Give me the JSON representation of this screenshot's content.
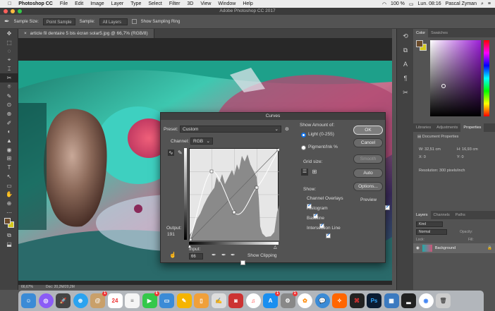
{
  "menubar": {
    "app": "Photoshop CC",
    "items": [
      "File",
      "Edit",
      "Image",
      "Layer",
      "Type",
      "Select",
      "Filter",
      "3D",
      "View",
      "Window",
      "Help"
    ],
    "battery": "100 %",
    "clock": "Lun. 08:16",
    "user": "Pascal Zyman"
  },
  "window": {
    "title": "Adobe Photoshop CC 2017"
  },
  "options": {
    "sample_size_label": "Sample Size:",
    "sample_size_value": "Point Sample",
    "sample_label": "Sample:",
    "sample_value": "All Layers",
    "show_ring": "Show Sampling Ring"
  },
  "document": {
    "tab": "article fil dentaire 5 bis écran solar5.jpg @ 66,7% (RGB/8)",
    "zoom": "66,67%",
    "doc_info": "Doc: 20,2M/20,2M"
  },
  "tools": [
    "✥",
    "⬚",
    "◌",
    "⌖",
    "⌶",
    "✂",
    "⌾",
    "✎",
    "⊙",
    "⊕",
    "✐",
    "◐",
    "▲",
    "◉",
    "⊞",
    "T",
    "↖",
    "▭",
    "✋",
    "⊕",
    "⋯",
    "▣",
    "⧉",
    "⬓"
  ],
  "colors": {
    "fg": "#6b4b2a",
    "bg": "#d4c91e",
    "accent": "#1473e6"
  },
  "color_panel": {
    "tabs": [
      "Color",
      "Swatches"
    ]
  },
  "properties": {
    "tabs": [
      "Libraries",
      "Adjustments",
      "Properties"
    ],
    "heading": "Document Properties",
    "w_label": "W:",
    "w_value": "32,51 cm",
    "h_label": "H:",
    "h_value": "16,93 cm",
    "x_label": "X:",
    "x_value": "0",
    "y_label": "Y:",
    "y_value": "0",
    "resolution": "Resolution: 300 pixels/inch"
  },
  "layers": {
    "tabs": [
      "Layers",
      "Channels",
      "Paths"
    ],
    "kind": "Kind",
    "mode": "Normal",
    "opacity_label": "Opacity:",
    "lock_label": "Lock:",
    "fill_label": "Fill:",
    "layer_name": "Background"
  },
  "curves": {
    "title": "Curves",
    "preset_label": "Preset:",
    "preset_value": "Custom",
    "channel_label": "Channel:",
    "channel_value": "RGB",
    "output_label": "Output:",
    "output_value": "191",
    "input_label": "Input:",
    "input_value": "66",
    "show_clipping": "Show Clipping",
    "show_amount_label": "Show Amount of:",
    "light": "Light  (0-255)",
    "pigment": "Pigment/Ink %",
    "grid_size": "Grid size:",
    "show_label": "Show:",
    "opts": [
      "Channel Overlays",
      "Histogram",
      "Baseline",
      "Intersection Line"
    ],
    "buttons": {
      "ok": "OK",
      "cancel": "Cancel",
      "smooth": "Smooth",
      "auto": "Auto",
      "options": "Options..."
    },
    "preview": "Preview"
  },
  "dock": {
    "badges": {
      "calendar": "24",
      "contacts": "1",
      "facetime": "6",
      "appstore": "1",
      "prefs": "1"
    }
  }
}
